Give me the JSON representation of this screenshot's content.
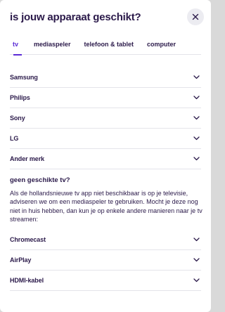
{
  "modal": {
    "title": "is jouw apparaat geschikt?",
    "close_icon": "close-icon"
  },
  "tabs": [
    {
      "label": "tv",
      "active": true
    },
    {
      "label": "mediaspeler",
      "active": false
    },
    {
      "label": "telefoon & tablet",
      "active": false
    },
    {
      "label": "computer",
      "active": false
    }
  ],
  "brands": [
    {
      "label": "Samsung"
    },
    {
      "label": "Philips"
    },
    {
      "label": "Sony"
    },
    {
      "label": "LG"
    },
    {
      "label": "Ander merk"
    }
  ],
  "no_tv": {
    "title": "geen geschikte tv?",
    "text": "Als de hollandsnieuwe tv app niet beschikbaar is op je televisie, adviseren we om een mediaspeler te gebruiken. Mocht je deze nog niet in huis hebben, dan kun je op enkele andere manieren naar je tv streamen:"
  },
  "devices": [
    {
      "label": "Chromecast"
    },
    {
      "label": "AirPlay"
    },
    {
      "label": "HDMI-kabel"
    }
  ],
  "colors": {
    "accent": "#5b2bd6",
    "text": "#2b1a4a",
    "divider": "#e4e4ea"
  }
}
